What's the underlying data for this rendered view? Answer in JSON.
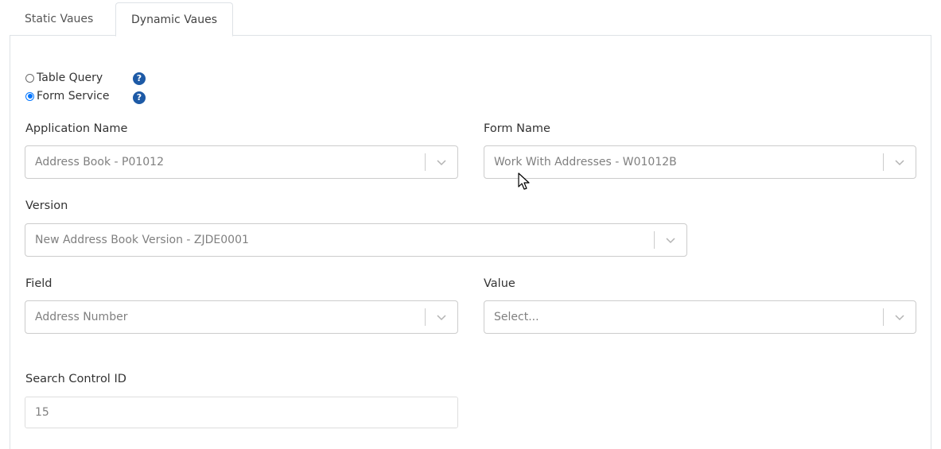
{
  "tabs": [
    {
      "label": "Static Vaues",
      "active": false
    },
    {
      "label": "Dynamic Vaues",
      "active": true
    }
  ],
  "source": {
    "options": [
      {
        "label": "Table Query",
        "selected": false,
        "help_icon": "question-circle-icon"
      },
      {
        "label": "Form Service",
        "selected": true,
        "help_icon": "question-circle-icon"
      }
    ]
  },
  "form": {
    "application_name": {
      "label": "Application Name",
      "value": "Address Book - P01012"
    },
    "form_name": {
      "label": "Form Name",
      "value": "Work With Addresses - W01012B"
    },
    "version": {
      "label": "Version",
      "value": "New Address Book Version - ZJDE0001"
    },
    "field": {
      "label": "Field",
      "value": "Address Number"
    },
    "value": {
      "label": "Value",
      "placeholder": "Select..."
    },
    "search_control_id": {
      "label": "Search Control ID",
      "value": "15"
    }
  },
  "icons": {
    "dropdown": "chevron-down-icon",
    "help": "question-circle-icon",
    "cursor": "mouse-pointer-icon"
  },
  "colors": {
    "radio_accent": "#0075ff",
    "help_icon": "#1d5aa6",
    "border": "#cccccc"
  }
}
